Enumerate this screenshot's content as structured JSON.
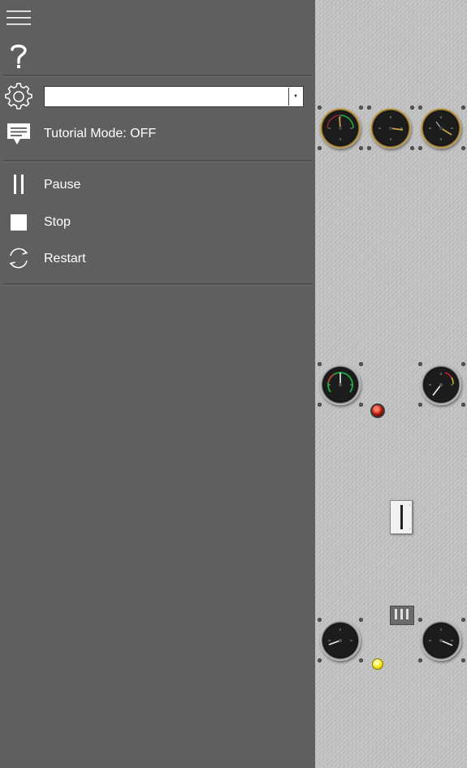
{
  "menu": {
    "hamburger_icon": "menu-icon",
    "help_icon": "help-icon",
    "settings_icon": "gear-icon",
    "aircraft_select": {
      "value": ""
    },
    "tutorial": {
      "icon": "message-icon",
      "label": "Tutorial Mode: OFF"
    },
    "pause": {
      "icon": "pause-icon",
      "label": "Pause"
    },
    "stop": {
      "icon": "stop-icon",
      "label": "Stop"
    },
    "restart": {
      "icon": "refresh-icon",
      "label": "Restart"
    }
  },
  "colors": {
    "drawer_bg": "#5f5f5f",
    "panel_bg": "#c3c3c3",
    "gauge_face": "#1c1c1c",
    "gold_bezel": "#e6c777",
    "warning_light": "#b71c0c",
    "indicator_light": "#f2e40a"
  }
}
